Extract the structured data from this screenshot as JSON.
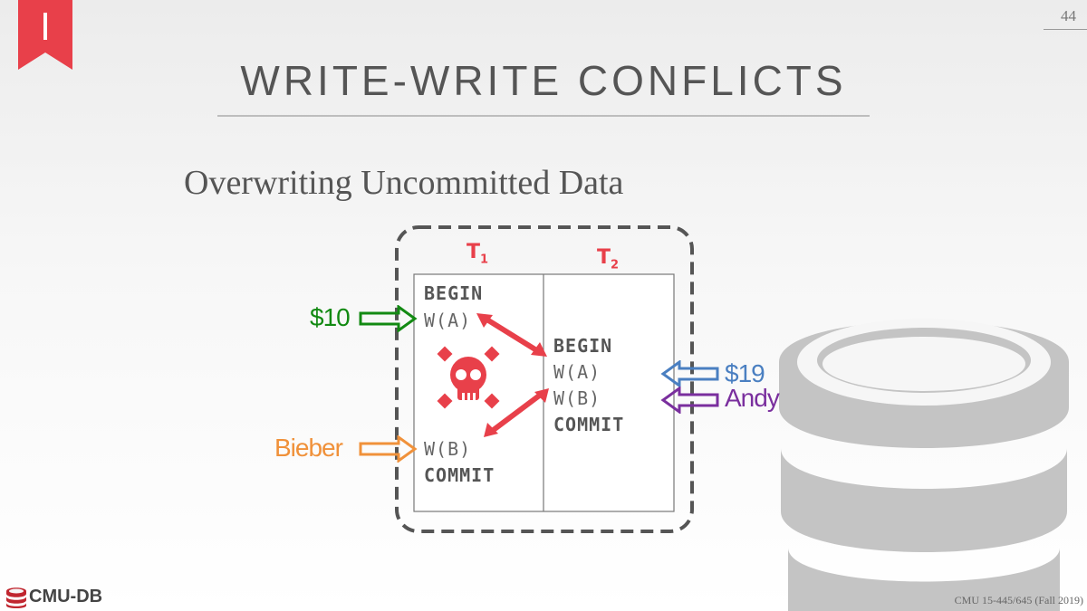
{
  "slide": {
    "number": "44",
    "title": "WRITE-WRITE CONFLICTS",
    "subtitle": "Overwriting Uncommitted Data",
    "footer_course": "CMU 15-445/645 (Fall 2019)",
    "logo_text": "CMU-DB"
  },
  "schedule": {
    "t1": {
      "name": "T",
      "sub": "1"
    },
    "t2": {
      "name": "T",
      "sub": "2"
    },
    "t1_ops_top": [
      "BEGIN",
      "W(A)"
    ],
    "t1_ops_bottom": [
      "W(B)",
      "COMMIT"
    ],
    "t2_ops": [
      "BEGIN",
      "W(A)",
      "W(B)",
      "COMMIT"
    ]
  },
  "annotations": {
    "t1_write_a": {
      "text": "$10",
      "color": "#138a13"
    },
    "t1_write_b": {
      "text": "Bieber",
      "color": "#f0913a"
    },
    "t2_write_a": {
      "text": "$19",
      "color": "#4a7fc1"
    },
    "t2_write_b": {
      "text": "Andy",
      "color": "#7a2f9e"
    }
  },
  "colors": {
    "conflict": "#e8404a",
    "bookmark": "#e8404a",
    "frame": "#555555",
    "database_icon": "#c4c4c4"
  },
  "icons": [
    "bookmark-icon",
    "skull-crossbones-icon",
    "database-icon",
    "cmu-db-logo-icon"
  ]
}
